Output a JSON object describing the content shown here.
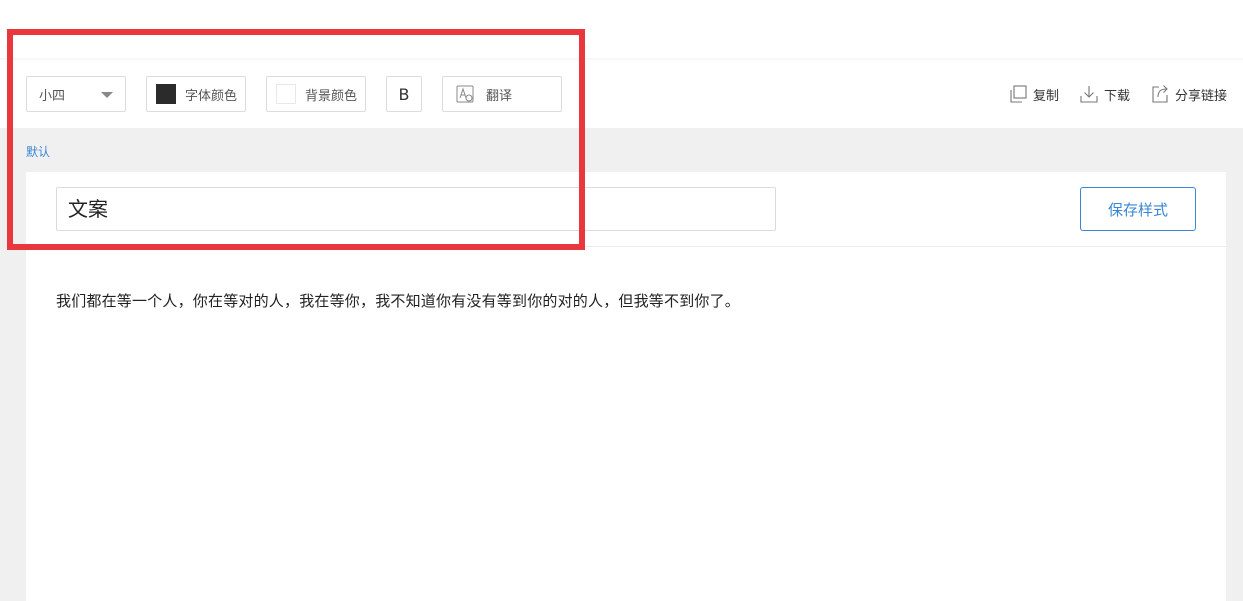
{
  "toolbar": {
    "font_size": "小四",
    "font_color_label": "字体颜色",
    "font_color_value": "#2b2b2b",
    "bg_color_label": "背景颜色",
    "bg_color_value": "#ffffff",
    "bold_label": "B",
    "translate_label": "翻译"
  },
  "actions": {
    "copy_label": "复制",
    "download_label": "下载",
    "share_label": "分享链接"
  },
  "style": {
    "default_label": "默认"
  },
  "editor": {
    "title_value": "文案",
    "save_style_label": "保存样式",
    "content_text": "我们都在等一个人，你在等对的人，我在等你，我不知道你有没有等到你的对的人，但我等不到你了。"
  },
  "colors": {
    "accent": "#3a86d6",
    "highlight_border": "#e8383d",
    "page_background": "#f0f0f0"
  },
  "icons": {
    "size_dropdown": "chevron-down-icon",
    "translate": "translate-icon",
    "copy": "copy-icon",
    "download": "download-icon",
    "share": "share-icon"
  }
}
